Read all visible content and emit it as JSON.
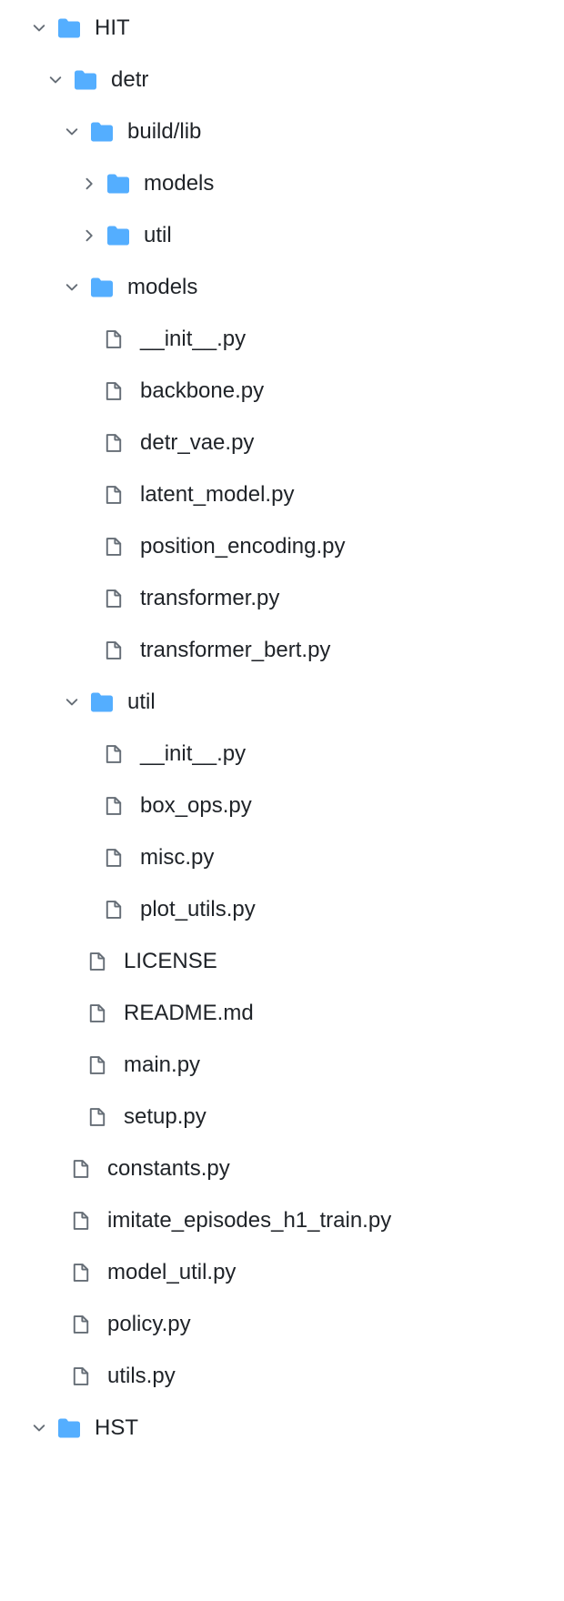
{
  "tree": {
    "hit": "HIT",
    "detr": "detr",
    "buildlib": "build/lib",
    "buildlib_models": "models",
    "buildlib_util": "util",
    "models": "models",
    "models_files": {
      "init": "__init__.py",
      "backbone": "backbone.py",
      "detr_vae": "detr_vae.py",
      "latent_model": "latent_model.py",
      "position_encoding": "position_encoding.py",
      "transformer": "transformer.py",
      "transformer_bert": "transformer_bert.py"
    },
    "util": "util",
    "util_files": {
      "init": "__init__.py",
      "box_ops": "box_ops.py",
      "misc": "misc.py",
      "plot_utils": "plot_utils.py"
    },
    "detr_files": {
      "license": "LICENSE",
      "readme": "README.md",
      "main": "main.py",
      "setup": "setup.py"
    },
    "hit_files": {
      "constants": "constants.py",
      "imitate": "imitate_episodes_h1_train.py",
      "model_util": "model_util.py",
      "policy": "policy.py",
      "utils": "utils.py"
    },
    "hst": "HST"
  }
}
